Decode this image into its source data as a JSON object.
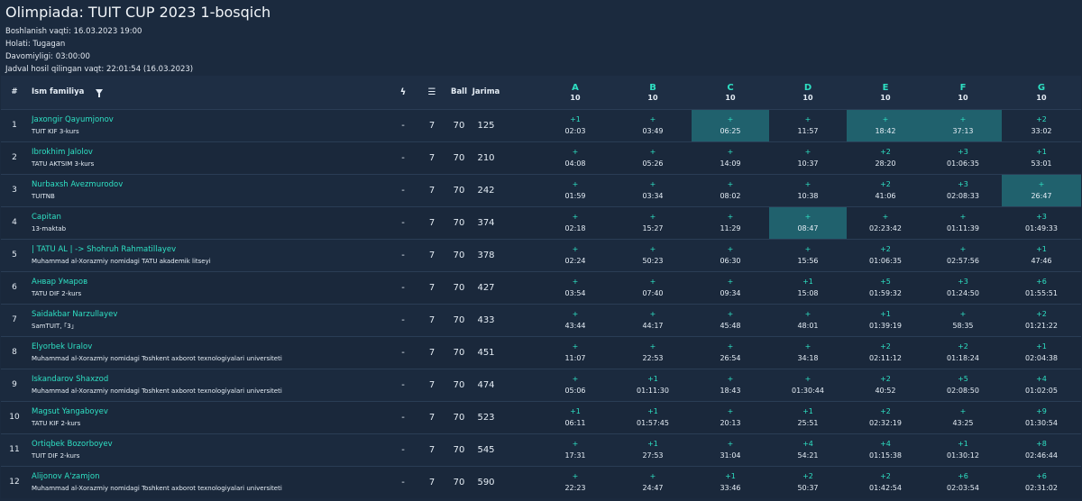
{
  "header": {
    "title": "Olimpiada: TUIT CUP 2023 1-bosqich",
    "meta": [
      "Boshlanish vaqti: 16.03.2023 19:00",
      "Holati: Tugagan",
      "Davomiyligi: 03:00:00",
      "Jadval hosil qilingan vaqt: 22:01:54 (16.03.2023)"
    ]
  },
  "table": {
    "columns": {
      "rank": "#",
      "name": "Ism familiya",
      "ball": "Ball",
      "jarima": "Jarima",
      "problems": [
        {
          "letter": "A",
          "points": "10"
        },
        {
          "letter": "B",
          "points": "10"
        },
        {
          "letter": "C",
          "points": "10"
        },
        {
          "letter": "D",
          "points": "10"
        },
        {
          "letter": "E",
          "points": "10"
        },
        {
          "letter": "F",
          "points": "10"
        },
        {
          "letter": "G",
          "points": "10"
        }
      ]
    },
    "rows": [
      {
        "rank": "1",
        "name": "Jaxongir Qayumjonov",
        "inst": "TUIT KIF 3-kurs",
        "dash": "-",
        "solved": "7",
        "ball": "70",
        "jarima": "125",
        "cells": [
          [
            "+1",
            "02:03",
            false
          ],
          [
            "+",
            "03:49",
            false
          ],
          [
            "+",
            "06:25",
            true
          ],
          [
            "+",
            "11:57",
            false
          ],
          [
            "+",
            "18:42",
            true
          ],
          [
            "+",
            "37:13",
            true
          ],
          [
            "+2",
            "33:02",
            false
          ]
        ]
      },
      {
        "rank": "2",
        "name": "Ibrokhim Jalolov",
        "inst": "TATU AKTSIM 3-kurs",
        "dash": "-",
        "solved": "7",
        "ball": "70",
        "jarima": "210",
        "cells": [
          [
            "+",
            "04:08",
            false
          ],
          [
            "+",
            "05:26",
            false
          ],
          [
            "+",
            "14:09",
            false
          ],
          [
            "+",
            "10:37",
            false
          ],
          [
            "+2",
            "28:20",
            false
          ],
          [
            "+3",
            "01:06:35",
            false
          ],
          [
            "+1",
            "53:01",
            false
          ]
        ]
      },
      {
        "rank": "3",
        "name": "Nurbaxsh Avezmurodov",
        "inst": "TUITNB",
        "dash": "-",
        "solved": "7",
        "ball": "70",
        "jarima": "242",
        "cells": [
          [
            "+",
            "01:59",
            false
          ],
          [
            "+",
            "03:34",
            false
          ],
          [
            "+",
            "08:02",
            false
          ],
          [
            "+",
            "10:38",
            false
          ],
          [
            "+2",
            "41:06",
            false
          ],
          [
            "+3",
            "02:08:33",
            false
          ],
          [
            "+",
            "26:47",
            true
          ]
        ]
      },
      {
        "rank": "4",
        "name": "Capitan",
        "inst": "13-maktab",
        "dash": "-",
        "solved": "7",
        "ball": "70",
        "jarima": "374",
        "cells": [
          [
            "+",
            "02:18",
            false
          ],
          [
            "+",
            "15:27",
            false
          ],
          [
            "+",
            "11:29",
            false
          ],
          [
            "+",
            "08:47",
            true
          ],
          [
            "+",
            "02:23:42",
            false
          ],
          [
            "+",
            "01:11:39",
            false
          ],
          [
            "+3",
            "01:49:33",
            false
          ]
        ]
      },
      {
        "rank": "5",
        "name": "| TATU AL | -> Shohruh Rahmatillayev",
        "inst": "Muhammad al-Xorazmiy nomidagi TATU akademik litseyi",
        "dash": "-",
        "solved": "7",
        "ball": "70",
        "jarima": "378",
        "cells": [
          [
            "+",
            "02:24",
            false
          ],
          [
            "+",
            "50:23",
            false
          ],
          [
            "+",
            "06:30",
            false
          ],
          [
            "+",
            "15:56",
            false
          ],
          [
            "+2",
            "01:06:35",
            false
          ],
          [
            "+",
            "02:57:56",
            false
          ],
          [
            "+1",
            "47:46",
            false
          ]
        ]
      },
      {
        "rank": "6",
        "name": "Анвар Умаров",
        "inst": "TATU DIF 2-kurs",
        "dash": "-",
        "solved": "7",
        "ball": "70",
        "jarima": "427",
        "cells": [
          [
            "+",
            "03:54",
            false
          ],
          [
            "+",
            "07:40",
            false
          ],
          [
            "+",
            "09:34",
            false
          ],
          [
            "+1",
            "15:08",
            false
          ],
          [
            "+5",
            "01:59:32",
            false
          ],
          [
            "+3",
            "01:24:50",
            false
          ],
          [
            "+6",
            "01:55:51",
            false
          ]
        ]
      },
      {
        "rank": "7",
        "name": "Saidakbar Narzullayev",
        "inst": "SamTUIT, ｢3｣",
        "dash": "-",
        "solved": "7",
        "ball": "70",
        "jarima": "433",
        "cells": [
          [
            "+",
            "43:44",
            false
          ],
          [
            "+",
            "44:17",
            false
          ],
          [
            "+",
            "45:48",
            false
          ],
          [
            "+",
            "48:01",
            false
          ],
          [
            "+1",
            "01:39:19",
            false
          ],
          [
            "+",
            "58:35",
            false
          ],
          [
            "+2",
            "01:21:22",
            false
          ]
        ]
      },
      {
        "rank": "8",
        "name": "Elyorbek Uralov",
        "inst": "Muhammad al-Xorazmiy nomidagi Toshkent axborot texnologiyalari universiteti",
        "dash": "-",
        "solved": "7",
        "ball": "70",
        "jarima": "451",
        "cells": [
          [
            "+",
            "11:07",
            false
          ],
          [
            "+",
            "22:53",
            false
          ],
          [
            "+",
            "26:54",
            false
          ],
          [
            "+",
            "34:18",
            false
          ],
          [
            "+2",
            "02:11:12",
            false
          ],
          [
            "+2",
            "01:18:24",
            false
          ],
          [
            "+1",
            "02:04:38",
            false
          ]
        ]
      },
      {
        "rank": "9",
        "name": "Iskandarov Shaxzod",
        "inst": "Muhammad al-Xorazmiy nomidagi Toshkent axborot texnologiyalari universiteti",
        "dash": "-",
        "solved": "7",
        "ball": "70",
        "jarima": "474",
        "cells": [
          [
            "+",
            "05:06",
            false
          ],
          [
            "+1",
            "01:11:30",
            false
          ],
          [
            "+",
            "18:43",
            false
          ],
          [
            "+",
            "01:30:44",
            false
          ],
          [
            "+2",
            "40:52",
            false
          ],
          [
            "+5",
            "02:08:50",
            false
          ],
          [
            "+4",
            "01:02:05",
            false
          ]
        ]
      },
      {
        "rank": "10",
        "name": "Magsut Yangaboyev",
        "inst": "TATU KIF 2-kurs",
        "dash": "-",
        "solved": "7",
        "ball": "70",
        "jarima": "523",
        "cells": [
          [
            "+1",
            "06:11",
            false
          ],
          [
            "+1",
            "01:57:45",
            false
          ],
          [
            "+",
            "20:13",
            false
          ],
          [
            "+1",
            "25:51",
            false
          ],
          [
            "+2",
            "02:32:19",
            false
          ],
          [
            "+",
            "43:25",
            false
          ],
          [
            "+9",
            "01:30:54",
            false
          ]
        ]
      },
      {
        "rank": "11",
        "name": "Ortiqbek Bozorboyev",
        "inst": "TUIT DIF 2-kurs",
        "dash": "-",
        "solved": "7",
        "ball": "70",
        "jarima": "545",
        "cells": [
          [
            "+",
            "17:31",
            false
          ],
          [
            "+1",
            "27:53",
            false
          ],
          [
            "+",
            "31:04",
            false
          ],
          [
            "+4",
            "54:21",
            false
          ],
          [
            "+4",
            "01:15:38",
            false
          ],
          [
            "+1",
            "01:30:12",
            false
          ],
          [
            "+8",
            "02:46:44",
            false
          ]
        ]
      },
      {
        "rank": "12",
        "name": "Alijonov A'zamjon",
        "inst": "Muhammad al-Xorazmiy nomidagi Toshkent axborot texnologiyalari universiteti",
        "dash": "-",
        "solved": "7",
        "ball": "70",
        "jarima": "590",
        "cells": [
          [
            "+",
            "22:23",
            false
          ],
          [
            "+",
            "24:47",
            false
          ],
          [
            "+1",
            "33:46",
            false
          ],
          [
            "+2",
            "50:37",
            false
          ],
          [
            "+2",
            "01:42:54",
            false
          ],
          [
            "+6",
            "02:03:54",
            false
          ],
          [
            "+6",
            "02:31:02",
            false
          ]
        ]
      }
    ]
  },
  "colors": {
    "accent": "#2ee0c3",
    "first_solve": "#20616d",
    "background": "#1b2a3e"
  }
}
